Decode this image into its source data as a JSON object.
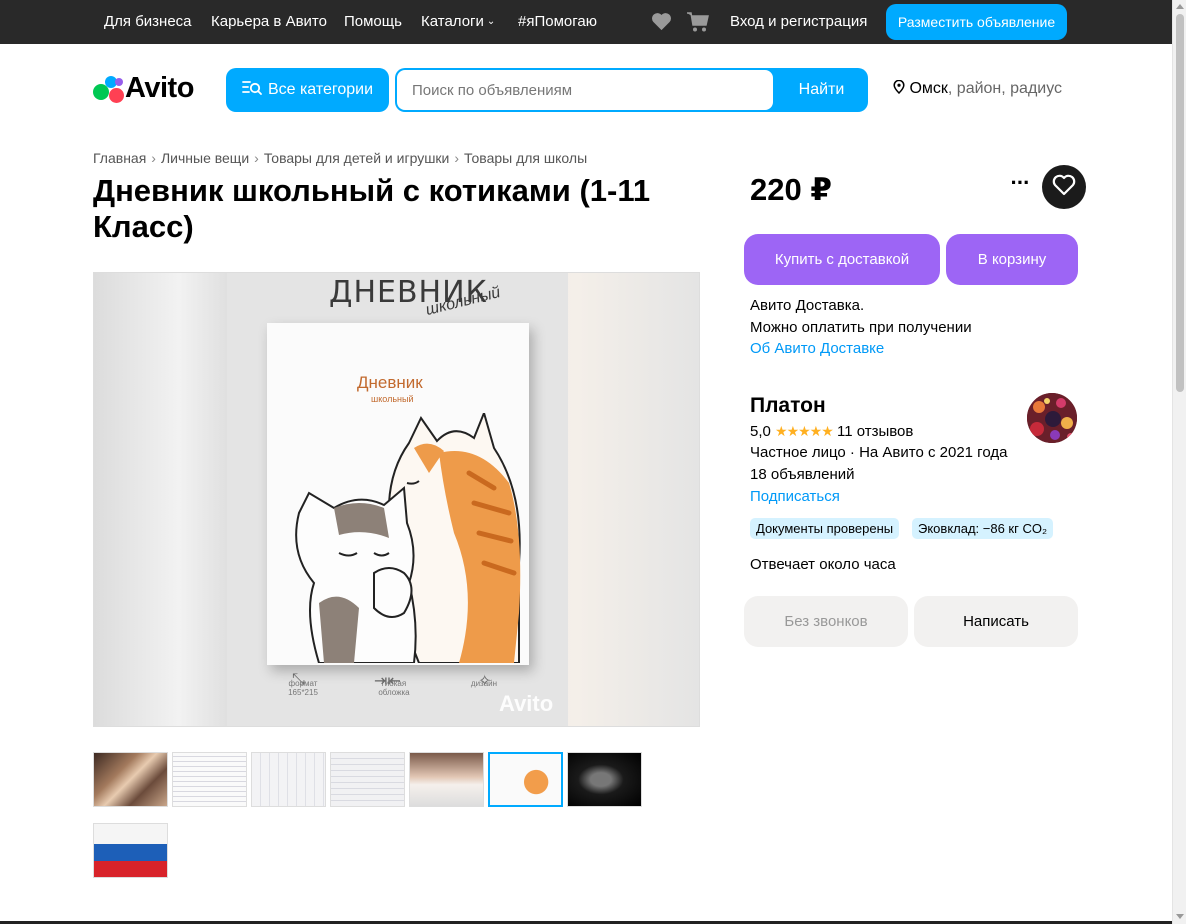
{
  "topbar": {
    "links": [
      "Для бизнеса",
      "Карьера в Авито",
      "Помощь",
      "Каталоги",
      "#яПомогаю"
    ],
    "login": "Вход и регистрация",
    "post_ad": "Разместить объявление"
  },
  "header": {
    "logo_text": "Avito",
    "all_categories": "Все категории",
    "search_placeholder": "Поиск по объявлениям",
    "search_button": "Найти",
    "city": "Омск",
    "location_rest": ", район, радиус"
  },
  "breadcrumbs": [
    "Главная",
    "Личные вещи",
    "Товары для детей и игрушки",
    "Товары для школы"
  ],
  "title": "Дневник школьный с котиками (1-11 Класс)",
  "image_text": {
    "heading": "ДНЕВНИК",
    "heading_script": "школьный",
    "cover_title": "Дневник",
    "cover_subtitle": "школьный",
    "feature_1": "формат 165*215",
    "feature_2": "гибкая обложка",
    "feature_3": "дизайн",
    "watermark": "Avito"
  },
  "thumbnails_count": 8,
  "active_thumbnail_index": 5,
  "price": "220 ₽",
  "buttons": {
    "buy_delivery": "Купить с доставкой",
    "to_cart": "В корзину",
    "no_calls": "Без звонков",
    "write": "Написать"
  },
  "delivery": {
    "line1": "Авито Доставка.",
    "line2": "Можно оплатить при получении",
    "link": "Об Авито Доставке"
  },
  "seller": {
    "name": "Платон",
    "rating": "5,0",
    "stars": "★★★★★",
    "reviews": "11 отзывов",
    "type_since": "Частное лицо · На Авито с 2021 года",
    "ads_count": "18 объявлений",
    "subscribe": "Подписаться",
    "badge_docs": "Документы проверены",
    "badge_eco": "Эковклад: −86 кг CO₂",
    "response_time": "Отвечает около часа"
  },
  "colors": {
    "accent_blue": "#00aaff",
    "purple": "#9d65f5",
    "link_blue": "#0099f7",
    "star": "#ffb021",
    "topbar": "#292929"
  }
}
